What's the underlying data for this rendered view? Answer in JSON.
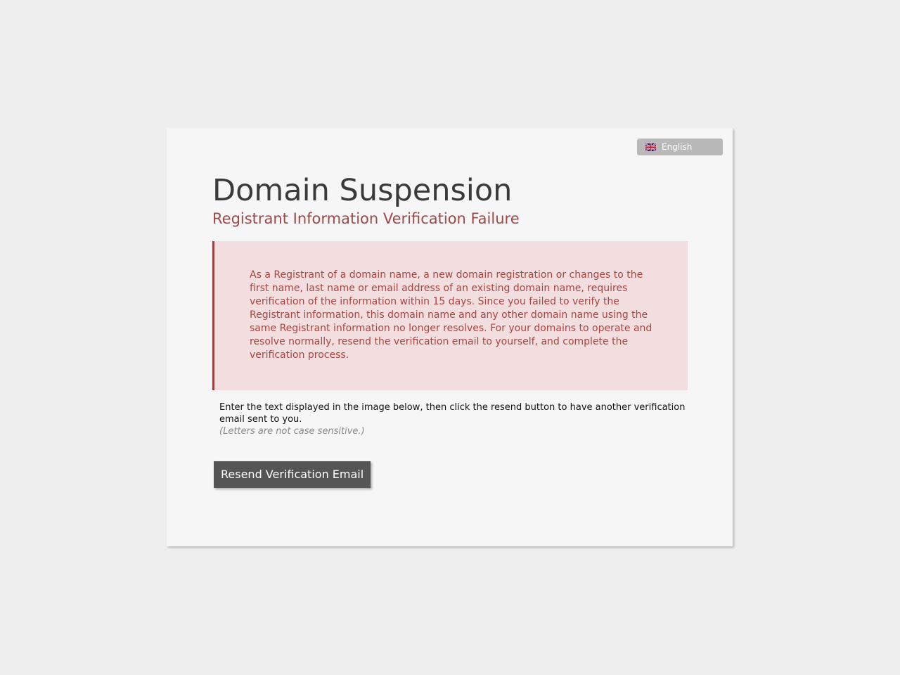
{
  "language": {
    "label": "English",
    "flag_icon": "uk-flag-icon"
  },
  "page": {
    "title": "Domain Suspension",
    "subtitle": "Registrant Information Verification Failure"
  },
  "alert": {
    "text": "As a Registrant of a domain name, a new domain registration or changes to the first name, last name or email address of an existing domain name, requires verification of the information within 15 days. Since you failed to verify the Registrant information, this domain name and any other domain name using the same Registrant information no longer resolves. For your domains to operate and resolve normally, resend the verification email to yourself, and complete the verification process."
  },
  "form": {
    "instructions": "Enter the text displayed in the image below, then click the resend button to have another verification email sent to you.",
    "note": "(Letters are not case sensitive.)",
    "resend_label": "Resend Verification Email"
  },
  "colors": {
    "page_background": "#eeeeee",
    "card_background": "#f6f6f6",
    "accent_red": "#a94442",
    "alert_background": "#f2dede",
    "button_background": "#555555",
    "language_button_background": "#b9b9b9"
  }
}
